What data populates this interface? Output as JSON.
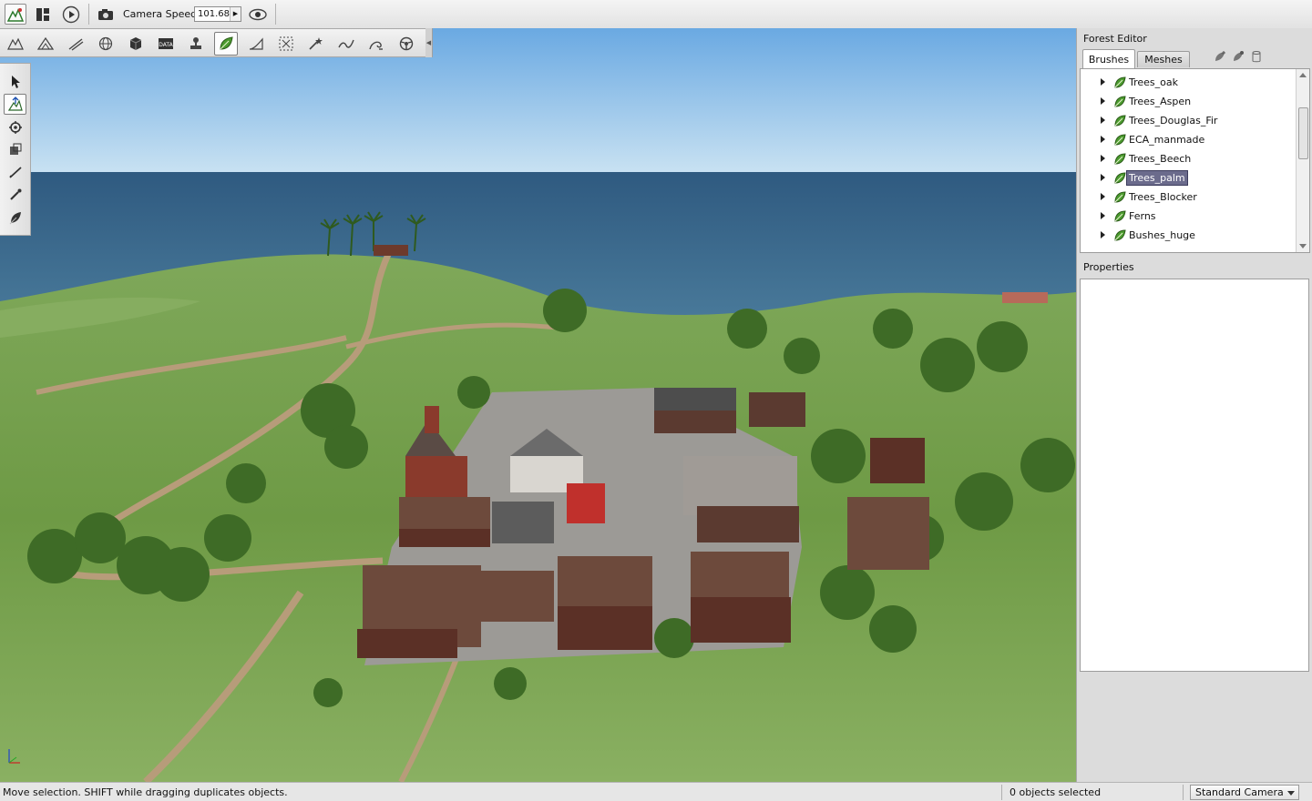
{
  "topbar": {
    "camera_speed_label": "Camera Speed",
    "camera_speed_value": "101.68"
  },
  "viewport": {
    "tool_icons": [
      "terrain-icon",
      "mountain-icon",
      "road-icon",
      "globe-icon",
      "cube-icon",
      "data-icon",
      "stamp-icon",
      "leaf-icon",
      "ramp-icon",
      "marquee-icon",
      "wand-icon",
      "wave-icon",
      "swirl-icon",
      "steering-icon"
    ],
    "active_tool": "leaf-icon",
    "side_tools": [
      "arrow-select-icon",
      "move-icon",
      "rotate-icon",
      "scale-icon",
      "paint-brush-icon",
      "eyedropper-icon",
      "erase-icon"
    ],
    "active_side_tool": "move-icon"
  },
  "forest_editor": {
    "title": "Forest Editor",
    "tabs": [
      {
        "label": "Brushes",
        "active": true
      },
      {
        "label": "Meshes",
        "active": false
      }
    ],
    "brushes": [
      {
        "label": "Trees_oak",
        "selected": false
      },
      {
        "label": "Trees_Aspen",
        "selected": false
      },
      {
        "label": "Trees_Douglas_Fir",
        "selected": false
      },
      {
        "label": "ECA_manmade",
        "selected": false
      },
      {
        "label": "Trees_Beech",
        "selected": false
      },
      {
        "label": "Trees_palm",
        "selected": true
      },
      {
        "label": "Trees_Blocker",
        "selected": false
      },
      {
        "label": "Ferns",
        "selected": false
      },
      {
        "label": "Bushes_huge",
        "selected": false
      }
    ]
  },
  "properties": {
    "title": "Properties"
  },
  "statusbar": {
    "message": "Move selection.  SHIFT while dragging duplicates objects.",
    "selection_count": "0 objects selected",
    "camera_mode": "Standard Camera"
  },
  "colors": {
    "selection": "#6b6b8c",
    "sky_top": "#7fb7e6",
    "ocean": "#3f6c8e",
    "grass": "#6f9a46",
    "dirt_road": "#b79c7a"
  }
}
